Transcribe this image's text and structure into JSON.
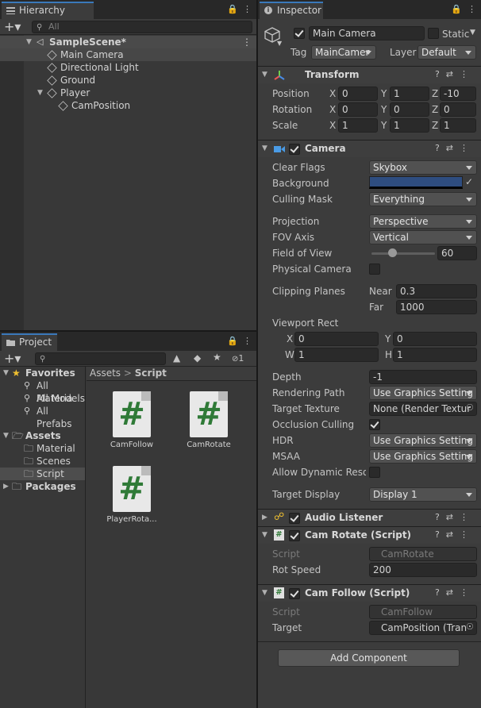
{
  "hierarchy": {
    "tab": "Hierarchy",
    "search_placeholder": "All",
    "scene": "SampleScene*",
    "items": [
      "Main Camera",
      "Directional Light",
      "Ground",
      "Player",
      "CamPosition"
    ]
  },
  "project": {
    "tab": "Project",
    "hidden_count": "1",
    "favorites": {
      "label": "Favorites",
      "items": [
        "All Materia",
        "All Models",
        "All Prefabs"
      ]
    },
    "assets": {
      "label": "Assets",
      "items": [
        "Material",
        "Scenes",
        "Script"
      ]
    },
    "packages": "Packages",
    "breadcrumb": {
      "root": "Assets",
      "sep": ">",
      "current": "Script"
    },
    "files": [
      {
        "name": "CamFollow"
      },
      {
        "name": "CamRotate"
      },
      {
        "name": "PlayerRota..."
      }
    ]
  },
  "inspector": {
    "tab": "Inspector",
    "object_name": "Main Camera",
    "static_label": "Static",
    "tag_label": "Tag",
    "tag_value": "MainCamer",
    "layer_label": "Layer",
    "layer_value": "Default",
    "transform": {
      "title": "Transform",
      "position": {
        "label": "Position",
        "x": "0",
        "y": "1",
        "z": "-10"
      },
      "rotation": {
        "label": "Rotation",
        "x": "0",
        "y": "0",
        "z": "0"
      },
      "scale": {
        "label": "Scale",
        "x": "1",
        "y": "1",
        "z": "1"
      },
      "axis": {
        "x": "X",
        "y": "Y",
        "z": "Z"
      }
    },
    "camera": {
      "title": "Camera",
      "clear_flags": {
        "label": "Clear Flags",
        "value": "Skybox"
      },
      "background": {
        "label": "Background",
        "color": "#2e4d80"
      },
      "culling_mask": {
        "label": "Culling Mask",
        "value": "Everything"
      },
      "projection": {
        "label": "Projection",
        "value": "Perspective"
      },
      "fov_axis": {
        "label": "FOV Axis",
        "value": "Vertical"
      },
      "fov": {
        "label": "Field of View",
        "value": "60",
        "slider_fraction": 0.32
      },
      "physical_camera": {
        "label": "Physical Camera"
      },
      "clipping": {
        "label": "Clipping Planes",
        "near_label": "Near",
        "near": "0.3",
        "far_label": "Far",
        "far": "1000"
      },
      "viewport": {
        "label": "Viewport Rect",
        "x_label": "X",
        "x": "0",
        "y_label": "Y",
        "y": "0",
        "w_label": "W",
        "w": "1",
        "h_label": "H",
        "h": "1"
      },
      "depth": {
        "label": "Depth",
        "value": "-1"
      },
      "rendering_path": {
        "label": "Rendering Path",
        "value": "Use Graphics Setting"
      },
      "target_texture": {
        "label": "Target Texture",
        "value": "None (Render Textur"
      },
      "occlusion": {
        "label": "Occlusion Culling"
      },
      "hdr": {
        "label": "HDR",
        "value": "Use Graphics Setting"
      },
      "msaa": {
        "label": "MSAA",
        "value": "Use Graphics Setting"
      },
      "dynamic_res": {
        "label": "Allow Dynamic Resol"
      },
      "target_display": {
        "label": "Target Display",
        "value": "Display 1"
      }
    },
    "audio_listener": {
      "title": "Audio Listener"
    },
    "cam_rotate": {
      "title": "Cam Rotate (Script)",
      "script_label": "Script",
      "script_value": "CamRotate",
      "rot_label": "Rot Speed",
      "rot_value": "200"
    },
    "cam_follow": {
      "title": "Cam Follow (Script)",
      "script_label": "Script",
      "script_value": "CamFollow",
      "target_label": "Target",
      "target_value": "CamPosition (Tran"
    },
    "add_component": "Add Component"
  }
}
